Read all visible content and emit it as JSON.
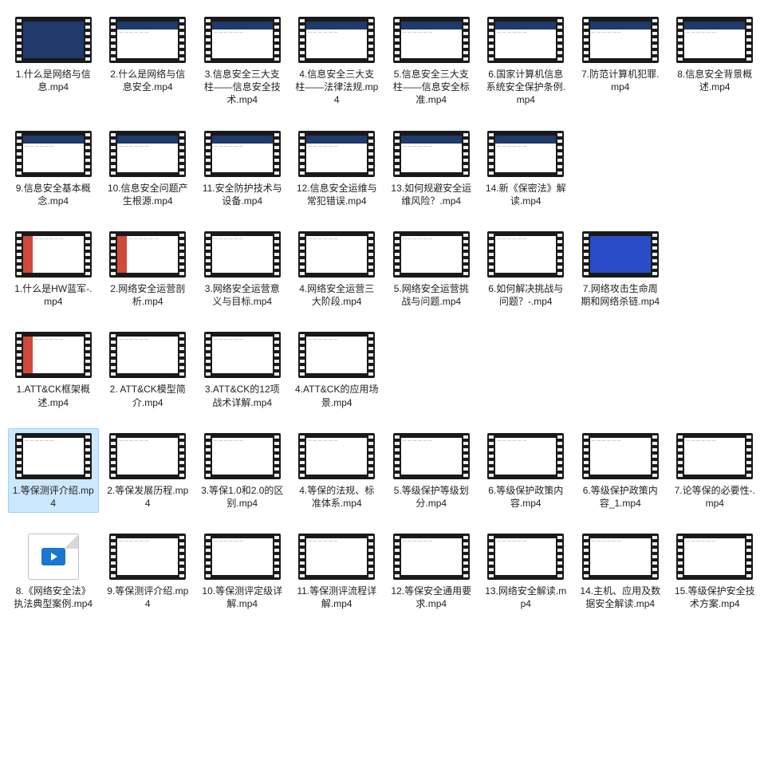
{
  "files": [
    {
      "name": "1.什么是网络与信息.mp4",
      "thumb": "blue-full",
      "row": 1
    },
    {
      "name": "2.什么是网络与信息安全.mp4",
      "thumb": "blue-header",
      "row": 1
    },
    {
      "name": "3.信息安全三大支柱——信息安全技术.mp4",
      "thumb": "blue-header",
      "row": 1
    },
    {
      "name": "4.信息安全三大支柱——法律法规.mp4",
      "thumb": "blue-header",
      "row": 1
    },
    {
      "name": "5.信息安全三大支柱——信息安全标准.mp4",
      "thumb": "blue-header",
      "row": 1
    },
    {
      "name": "6.国家计算机信息系统安全保护条例.mp4",
      "thumb": "blue-header",
      "row": 1
    },
    {
      "name": "7.防范计算机犯罪.mp4",
      "thumb": "blue-header",
      "row": 1
    },
    {
      "name": "8.信息安全背景概述.mp4",
      "thumb": "blue-header",
      "row": 1
    },
    {
      "name": "9.信息安全基本概念.mp4",
      "thumb": "blue-header",
      "row": 2
    },
    {
      "name": "10.信息安全问题产生根源.mp4",
      "thumb": "blue-header",
      "row": 2
    },
    {
      "name": "11.安全防护技术与设备.mp4",
      "thumb": "blue-header",
      "row": 2
    },
    {
      "name": "12.信息安全运维与常犯错误.mp4",
      "thumb": "blue-header",
      "row": 2
    },
    {
      "name": "13.如何规避安全运维风险？.mp4",
      "thumb": "blue-header",
      "row": 2
    },
    {
      "name": "14.新《保密法》解读.mp4",
      "thumb": "blue-header",
      "row": 2
    },
    {
      "name": "1.什么是HW蓝军-.mp4",
      "thumb": "content-left",
      "row": 3
    },
    {
      "name": "2.网络安全运营剖析.mp4",
      "thumb": "content-left",
      "row": 3
    },
    {
      "name": "3.网络安全运营意义与目标.mp4",
      "thumb": "plain",
      "row": 3
    },
    {
      "name": "4.网络安全运营三大阶段.mp4",
      "thumb": "plain",
      "row": 3
    },
    {
      "name": "5.网络安全运营挑战与问题.mp4",
      "thumb": "plain",
      "row": 3
    },
    {
      "name": "6.如何解决挑战与问题？-.mp4",
      "thumb": "plain",
      "row": 3
    },
    {
      "name": "7.网络攻击生命周期和网络杀链.mp4",
      "thumb": "blue-full darker",
      "row": 3
    },
    {
      "name": "1.ATT&CK框架概述.mp4",
      "thumb": "content-left",
      "row": 4
    },
    {
      "name": "2.  ATT&CK模型简介.mp4",
      "thumb": "plain",
      "row": 4
    },
    {
      "name": "3.ATT&CK的12项战术详解.mp4",
      "thumb": "plain",
      "row": 4
    },
    {
      "name": "4.ATT&CK的应用场景.mp4",
      "thumb": "plain",
      "row": 4
    },
    {
      "name": "1.等保测评介绍.mp4",
      "thumb": "plain",
      "row": 5,
      "selected": true
    },
    {
      "name": "2.等保发展历程.mp4",
      "thumb": "plain",
      "row": 5
    },
    {
      "name": "3.等保1.0和2.0的区别.mp4",
      "thumb": "plain",
      "row": 5
    },
    {
      "name": "4.等保的法规、标准体系.mp4",
      "thumb": "plain",
      "row": 5
    },
    {
      "name": "5.等级保护等级划分.mp4",
      "thumb": "plain",
      "row": 5
    },
    {
      "name": "6.等级保护政策内容.mp4",
      "thumb": "plain",
      "row": 5
    },
    {
      "name": "6.等级保护政策内容_1.mp4",
      "thumb": "plain",
      "row": 5
    },
    {
      "name": "7.论等保的必要性-.mp4",
      "thumb": "plain",
      "row": 5
    },
    {
      "name": "8.《网络安全法》执法典型案例.mp4",
      "thumb": "video-icon",
      "row": 6
    },
    {
      "name": "9.等保测评介绍.mp4",
      "thumb": "plain",
      "row": 6
    },
    {
      "name": "10.等保测评定级详解.mp4",
      "thumb": "plain",
      "row": 6
    },
    {
      "name": "11.等保测评流程详解.mp4",
      "thumb": "plain",
      "row": 6
    },
    {
      "name": "12.等保安全通用要求.mp4",
      "thumb": "plain",
      "row": 6
    },
    {
      "name": "13.网络安全解读.mp4",
      "thumb": "plain",
      "row": 6
    },
    {
      "name": "14.主机、应用及数据安全解读.mp4",
      "thumb": "plain",
      "row": 6
    },
    {
      "name": "15.等级保护安全技术方案.mp4",
      "thumb": "plain",
      "row": 6
    }
  ]
}
